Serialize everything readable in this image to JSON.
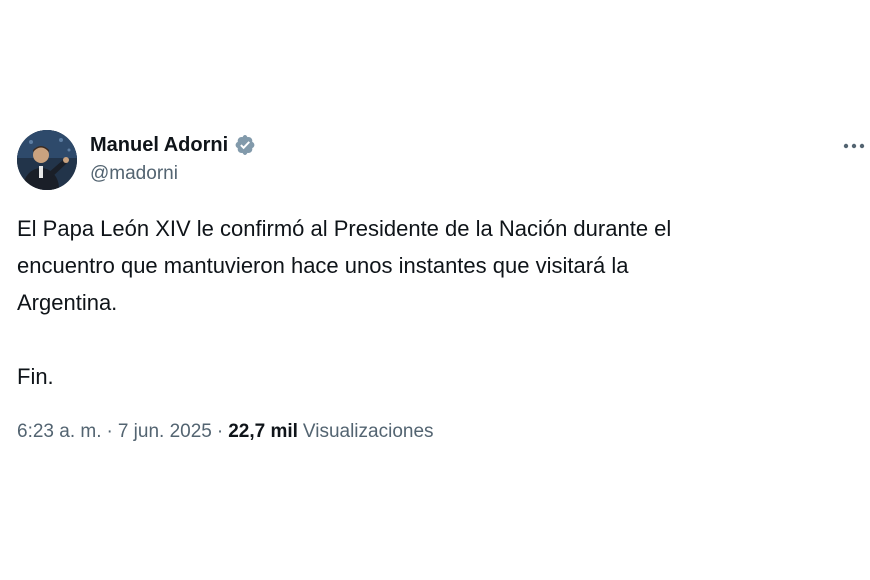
{
  "author": {
    "display_name": "Manuel Adorni",
    "handle": "@madorni",
    "verified": true,
    "verified_color": "#829aab",
    "avatar_icon": "user-avatar"
  },
  "tweet": {
    "lines": [
      "El Papa León XIV le confirmó al Presidente de la Nación durante el",
      "encuentro que mantuvieron hace unos instantes que visitará la",
      "Argentina."
    ],
    "closing": "Fin."
  },
  "meta": {
    "time": "6:23 a. m.",
    "separator": "·",
    "date": "7 jun. 2025",
    "views_count": "22,7 mil",
    "views_label": "Visualizaciones"
  },
  "colors": {
    "text_primary": "#0f1419",
    "text_secondary": "#536471",
    "background": "#ffffff"
  },
  "icons": {
    "more": "more-horizontal-icon",
    "verified": "verified-badge-icon"
  }
}
